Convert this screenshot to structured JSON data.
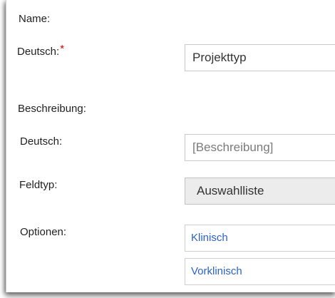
{
  "form": {
    "name_label": "Name:",
    "name_de_label": "Deutsch:",
    "required_marker": "*",
    "name_de_value": "Projekttyp",
    "desc_label": "Beschreibung:",
    "desc_de_label": "Deutsch:",
    "desc_de_placeholder": "[Beschreibung]",
    "fieldtype_label": "Feldtyp:",
    "fieldtype_value": "Auswahlliste",
    "options_label": "Optionen:",
    "options": [
      "Klinisch",
      "Vorklinisch"
    ]
  },
  "colors": {
    "required": "#d40000",
    "link": "#2a62c9"
  }
}
